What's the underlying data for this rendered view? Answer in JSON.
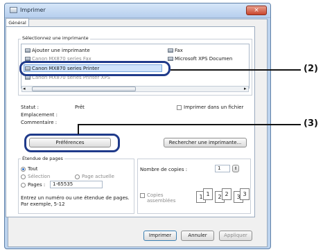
{
  "window": {
    "title": "Imprimer",
    "close_glyph": "×"
  },
  "tabs": [
    {
      "label": "Général"
    }
  ],
  "printer_group": {
    "legend": "Sélectionnez une imprimante",
    "items_left": [
      {
        "label": "Ajouter une imprimante",
        "icon": "add-printer-icon"
      },
      {
        "label": "Canon MX870 series Fax",
        "icon": "fax-icon"
      },
      {
        "label": "Canon MX870 series Printer",
        "icon": "printer-icon",
        "selected": true
      },
      {
        "label": "Canon MX870 series Printer XPS",
        "icon": "printer-icon"
      }
    ],
    "items_right": [
      {
        "label": "Fax",
        "icon": "fax-icon"
      },
      {
        "label": "Microsoft XPS Documen",
        "icon": "printer-icon"
      }
    ],
    "scroll_left": "◂",
    "scroll_right": "▸"
  },
  "status": {
    "status_label": "Statut :",
    "status_value": "Prêt",
    "location_label": "Emplacement :",
    "comment_label": "Commentaire :",
    "print_to_file_label": "Imprimer dans un fichier",
    "preferences_button": "Préférences",
    "find_printer_button": "Rechercher une imprimante..."
  },
  "page_range": {
    "legend": "Étendue de pages",
    "all_label": "Tout",
    "selection_label": "Sélection",
    "current_page_label": "Page actuelle",
    "pages_label": "Pages :",
    "pages_value": "1-65535",
    "hint": "Entrez un numéro ou une étendue de pages. Par exemple, 5-12"
  },
  "copies": {
    "count_label": "Nombre de copies :",
    "count_value": "1",
    "collate_label": "Copies assemblées",
    "collate_icons": [
      "1",
      "1",
      "2",
      "2",
      "3",
      "3"
    ]
  },
  "footer": {
    "print_button": "Imprimer",
    "cancel_button": "Annuler",
    "apply_button": "Appliquer"
  },
  "callouts": {
    "printer_label": "(2)",
    "preferences_label": "(3)"
  },
  "colors": {
    "callout_border": "#1f3a8a",
    "selection": "#cfe3fb",
    "window_frame": "#bcd3ee"
  }
}
